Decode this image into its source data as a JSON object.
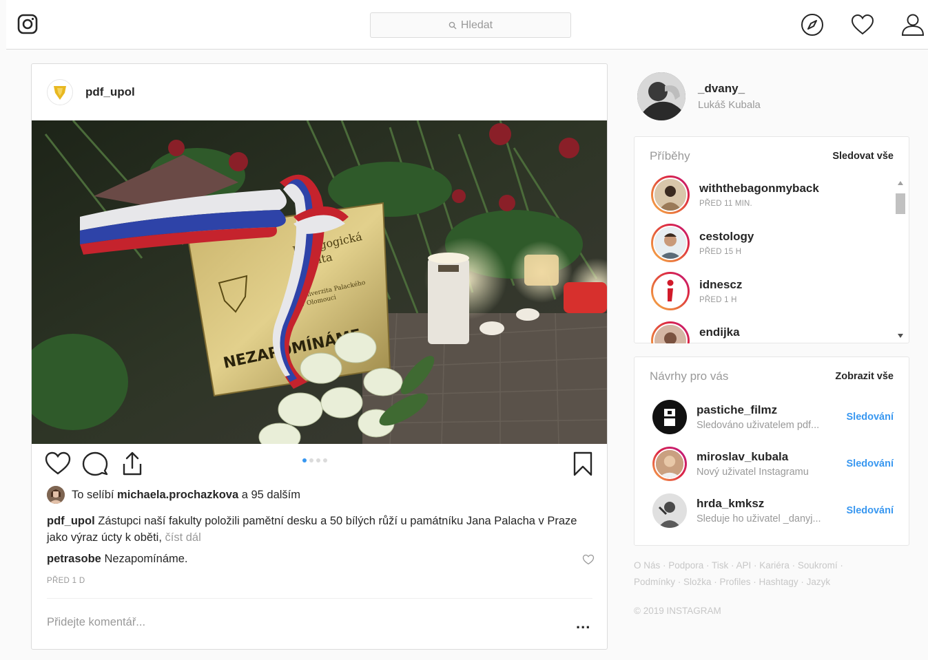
{
  "search": {
    "placeholder": "Hledat"
  },
  "post": {
    "username": "pdf_upol",
    "likes": {
      "prefix": "To se ",
      "liked": "líbí",
      "user": "michaela.prochazkova",
      "rest": " a 95 dalším"
    },
    "caption": {
      "user": "pdf_upol",
      "text": " Zástupci naší fakulty položili pamětní desku a 50 bílých růží u památníku Jana Palacha v Praze jako výraz úcty k oběti,",
      "more": "číst dál"
    },
    "comment": {
      "user": "petrasobe",
      "text": " Nezapomínáme."
    },
    "time": "PŘED 1 D",
    "add_comment_placeholder": "Přidejte komentář...",
    "options": "...",
    "carousel": {
      "count": 4,
      "active": 0
    },
    "photo_text": {
      "faculty": "Pedagogická fakulta",
      "uni": "Univerzita Palackého v Olomouci",
      "motto": "NEZAPOMÍNÁME"
    }
  },
  "profile": {
    "username": "_dvany_",
    "fullname": "Lukáš Kubala"
  },
  "stories": {
    "title": "Příběhy",
    "link": "Sledovat vše",
    "items": [
      {
        "name": "withthebagonmyback",
        "time": "PŘED 11 MIN."
      },
      {
        "name": "cestology",
        "time": "PŘED 15 H"
      },
      {
        "name": "idnescz",
        "time": "PŘED 1 H"
      },
      {
        "name": "endijka",
        "time": ""
      }
    ]
  },
  "suggestions": {
    "title": "Návrhy pro vás",
    "link": "Zobrazit vše",
    "items": [
      {
        "name": "pastiche_filmz",
        "desc": "Sledováno uživatelem pdf...",
        "action": "Sledování"
      },
      {
        "name": "miroslav_kubala",
        "desc": "Nový uživatel Instagramu",
        "action": "Sledování"
      },
      {
        "name": "hrda_kmksz",
        "desc": "Sleduje ho uživatel _danyj...",
        "action": "Sledování"
      }
    ]
  },
  "footer": {
    "links1": "O Nás · Podpora · Tisk · API · Kariéra · Soukromí ·",
    "links2": "Podmínky · Složka · Profiles · Hashtagy · Jazyk",
    "copyright": "© 2019 INSTAGRAM"
  },
  "colors": {
    "accent": "#3897f0",
    "border": "#dbdbdb",
    "muted": "#999999"
  }
}
